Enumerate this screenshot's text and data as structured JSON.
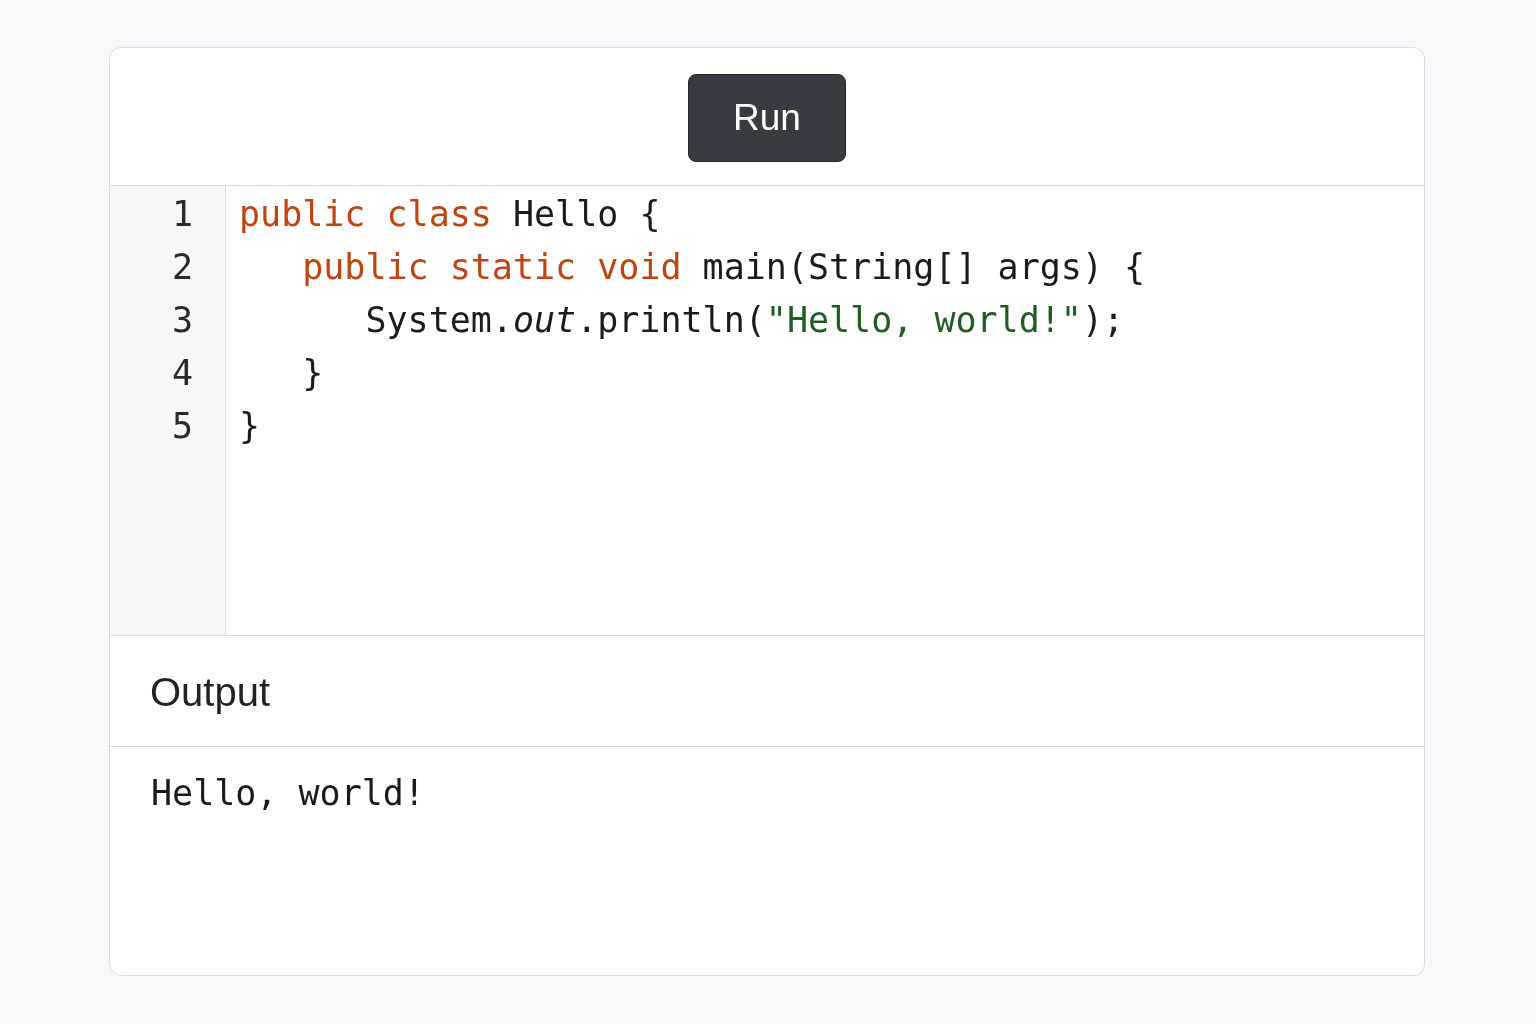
{
  "toolbar": {
    "run_button": {
      "label": "Run"
    }
  },
  "editor": {
    "lines": [
      {
        "number": "1",
        "tokens": [
          {
            "kind": "keyword",
            "text": "public "
          },
          {
            "kind": "keyword",
            "text": "class"
          },
          {
            "kind": "plain",
            "text": " Hello {"
          }
        ]
      },
      {
        "number": "2",
        "tokens": [
          {
            "kind": "keyword",
            "text": "   public "
          },
          {
            "kind": "keyword",
            "text": "static "
          },
          {
            "kind": "keyword",
            "text": "void"
          },
          {
            "kind": "plain",
            "text": " main(String[] args) {"
          }
        ]
      },
      {
        "number": "3",
        "tokens": [
          {
            "kind": "plain",
            "text": "      System."
          },
          {
            "kind": "field",
            "text": "out"
          },
          {
            "kind": "plain",
            "text": ".println("
          },
          {
            "kind": "string",
            "text": "\"Hello, world!\""
          },
          {
            "kind": "plain",
            "text": ");"
          }
        ]
      },
      {
        "number": "4",
        "tokens": [
          {
            "kind": "plain",
            "text": "   }"
          }
        ]
      },
      {
        "number": "5",
        "tokens": [
          {
            "kind": "plain",
            "text": "}"
          }
        ]
      }
    ]
  },
  "output": {
    "title": "Output",
    "text": "Hello, world!"
  }
}
